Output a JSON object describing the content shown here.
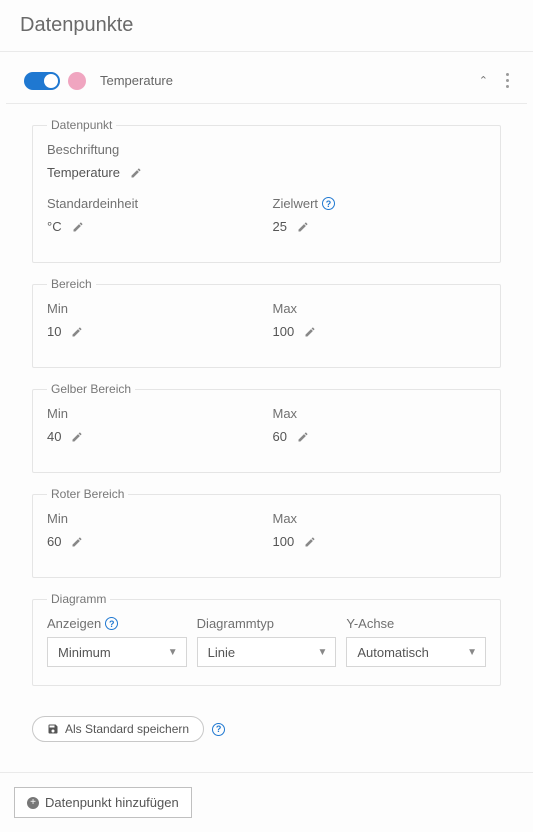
{
  "page_title": "Datenpunkte",
  "panel": {
    "title": "Temperature",
    "color": "#f0a5c0",
    "enabled": true
  },
  "sections": {
    "datenpunkt": {
      "legend": "Datenpunkt",
      "beschriftung": {
        "label": "Beschriftung",
        "value": "Temperature"
      },
      "standardeinheit": {
        "label": "Standardeinheit",
        "value": "°C"
      },
      "zielwert": {
        "label": "Zielwert",
        "value": "25"
      }
    },
    "bereich": {
      "legend": "Bereich",
      "min": {
        "label": "Min",
        "value": "10"
      },
      "max": {
        "label": "Max",
        "value": "100"
      }
    },
    "gelb": {
      "legend": "Gelber Bereich",
      "min": {
        "label": "Min",
        "value": "40"
      },
      "max": {
        "label": "Max",
        "value": "60"
      }
    },
    "rot": {
      "legend": "Roter Bereich",
      "min": {
        "label": "Min",
        "value": "60"
      },
      "max": {
        "label": "Max",
        "value": "100"
      }
    },
    "diagramm": {
      "legend": "Diagramm",
      "anzeigen": {
        "label": "Anzeigen",
        "value": "Minimum"
      },
      "typ": {
        "label": "Diagrammtyp",
        "value": "Linie"
      },
      "yachse": {
        "label": "Y-Achse",
        "value": "Automatisch"
      }
    }
  },
  "buttons": {
    "save_default": "Als Standard speichern",
    "add_datapoint": "Datenpunkt hinzufügen"
  }
}
